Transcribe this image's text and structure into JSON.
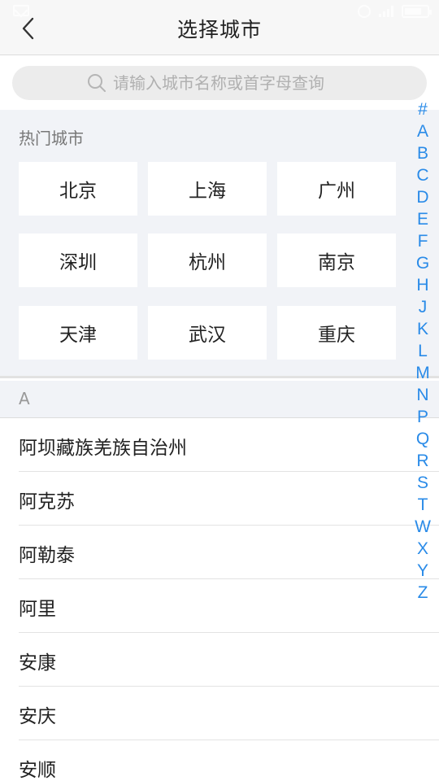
{
  "header": {
    "title": "选择城市"
  },
  "search": {
    "placeholder": "请输入城市名称或首字母查询"
  },
  "hot": {
    "title": "热门城市",
    "cities": [
      "北京",
      "上海",
      "广州",
      "深圳",
      "杭州",
      "南京",
      "天津",
      "武汉",
      "重庆"
    ]
  },
  "section": {
    "letter": "A"
  },
  "list": {
    "cities": [
      "阿坝藏族羌族自治州",
      "阿克苏",
      "阿勒泰",
      "阿里",
      "安康",
      "安庆",
      "安顺"
    ]
  },
  "index": {
    "letters": [
      "#",
      "A",
      "B",
      "C",
      "D",
      "E",
      "F",
      "G",
      "H",
      "J",
      "K",
      "L",
      "M",
      "N",
      "P",
      "Q",
      "R",
      "S",
      "T",
      "W",
      "X",
      "Y",
      "Z"
    ]
  },
  "colors": {
    "accent": "#2a8be8",
    "section_bg": "#f1f3f7",
    "nav_bg": "#f7f7f7"
  }
}
